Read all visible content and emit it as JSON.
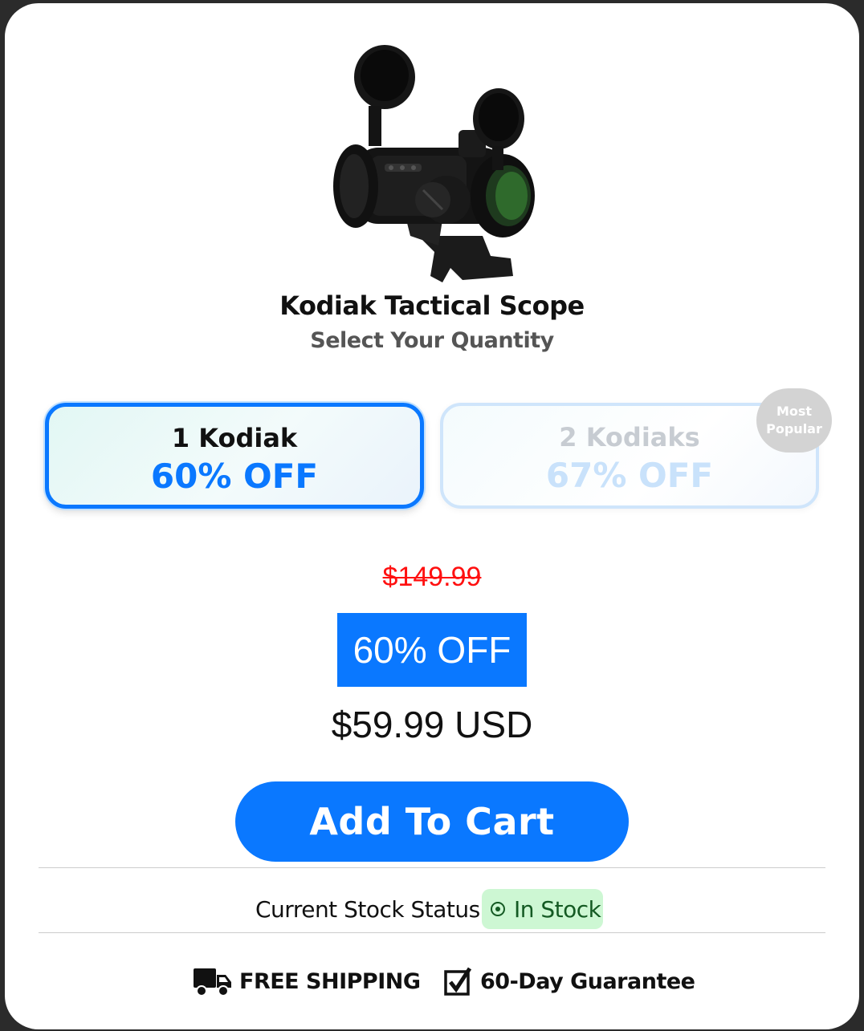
{
  "product": {
    "title": "Kodiak Tactical Scope",
    "subtitle": "Select Your Quantity",
    "image_icon": "scope-product-image"
  },
  "options": [
    {
      "qty_label": "1 Kodiak",
      "discount_label": "60% OFF",
      "selected": true
    },
    {
      "qty_label": "2 Kodiaks",
      "discount_label": "67% OFF",
      "selected": false
    }
  ],
  "badge": {
    "line1": "Most",
    "line2": "Popular"
  },
  "pricing": {
    "old_price": "$149.99",
    "discount": "60% OFF",
    "price": "$59.99 USD"
  },
  "cart": {
    "label": "Add To Cart"
  },
  "stock": {
    "label": "Current Stock Status",
    "status": "In Stock",
    "icon": "target-icon"
  },
  "features": [
    {
      "icon": "truck-icon",
      "label": "FREE SHIPPING"
    },
    {
      "icon": "checkbox-icon",
      "label": "60-Day Guarantee"
    }
  ],
  "colors": {
    "accent": "#0a78ff",
    "old_price": "#ff1010",
    "stock_bg": "#cdf7d3",
    "stock_text": "#145a23"
  }
}
